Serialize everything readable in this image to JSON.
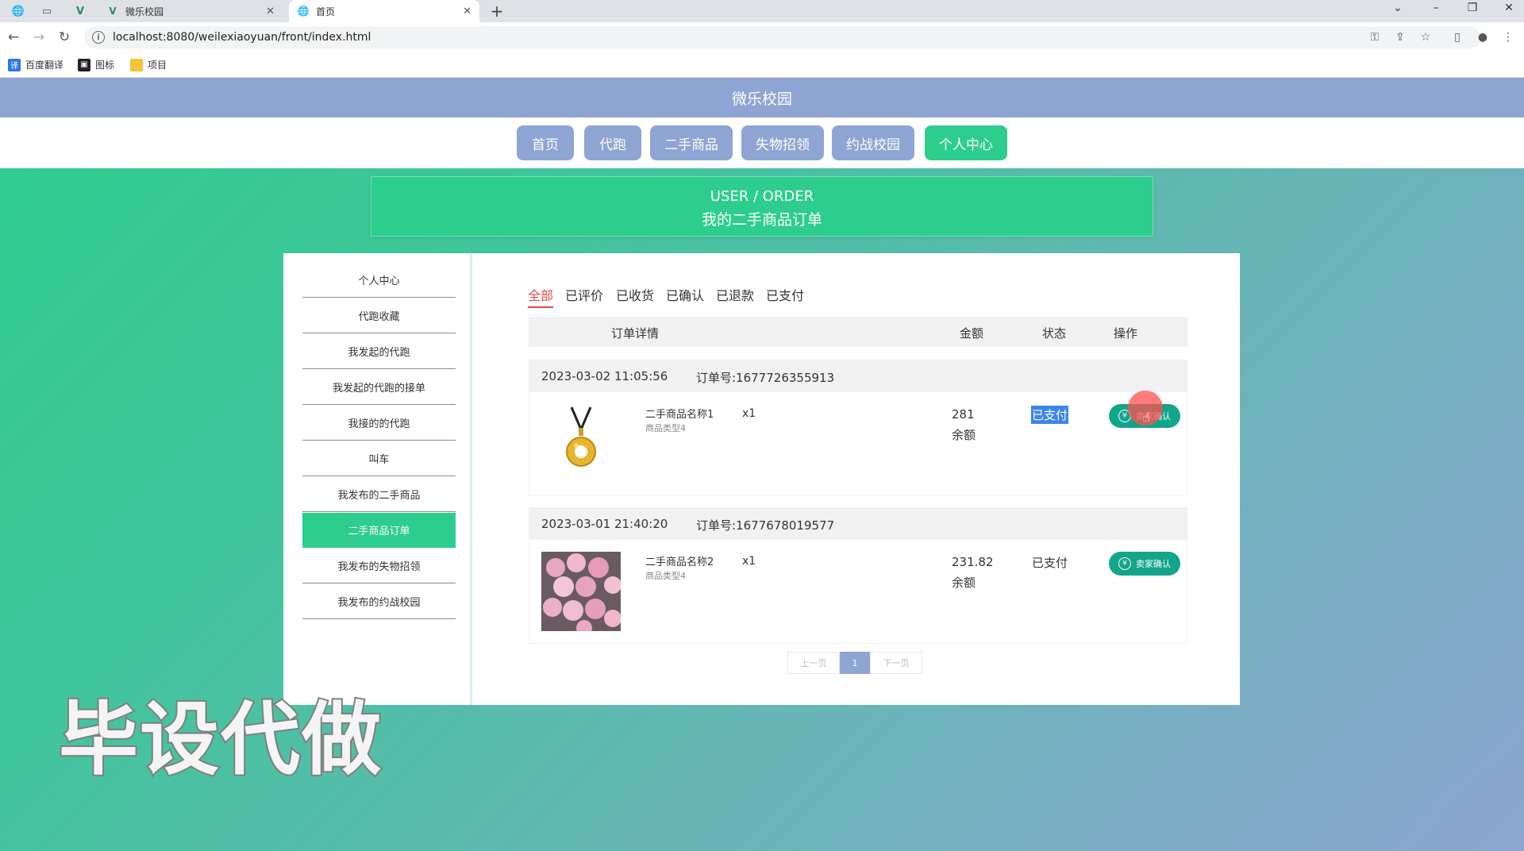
{
  "browser": {
    "tabs": [
      {
        "title": "微乐校园",
        "active": false
      },
      {
        "title": "首页",
        "active": true
      }
    ],
    "url": "localhost:8080/weilexiaoyuan/front/index.html",
    "bookmarks": [
      "百度翻译",
      "图标",
      "项目"
    ],
    "icons": {
      "back": "←",
      "forward": "→",
      "reload": "↻",
      "new_tab": "+",
      "close": "✕"
    }
  },
  "site": {
    "title": "微乐校园",
    "nav": [
      "首页",
      "代跑",
      "二手商品",
      "失物招领",
      "约战校园",
      "个人中心"
    ],
    "active_nav": "个人中心"
  },
  "banner": {
    "en": "USER / ORDER",
    "cn": "我的二手商品订单"
  },
  "sidebar": {
    "items": [
      "个人中心",
      "代跑收藏",
      "我发起的代跑",
      "我发起的代跑的接单",
      "我接的的代跑",
      "叫车",
      "我发布的二手商品",
      "二手商品订单",
      "我发布的失物招领",
      "我发布的约战校园"
    ],
    "active": "二手商品订单"
  },
  "filters": {
    "items": [
      "全部",
      "已评价",
      "已收货",
      "已确认",
      "已退款",
      "已支付"
    ],
    "active": "全部"
  },
  "table": {
    "headers": [
      "订单详情",
      "金额",
      "状态",
      "操作"
    ]
  },
  "orders": [
    {
      "time": "2023-03-02 11:05:56",
      "order_no": "订单号:1677726355913",
      "name": "二手商品名称1",
      "type": "商品类型4",
      "qty": "x1",
      "amount": "281",
      "pay_method": "余额",
      "status": "已支付",
      "action": "卖家确认"
    },
    {
      "time": "2023-03-01 21:40:20",
      "order_no": "订单号:1677678019577",
      "name": "二手商品名称2",
      "type": "商品类型4",
      "qty": "x1",
      "amount": "231.82",
      "pay_method": "余额",
      "status": "已支付",
      "action": "卖家确认"
    }
  ],
  "pager": {
    "prev": "上一页",
    "current": "1",
    "next": "下一页"
  },
  "watermark": "毕设代做",
  "colors": {
    "primary": "#2dcd8e",
    "secondary": "#8ea4d2",
    "action": "#13a58a",
    "filter_active": "#e24b4b"
  }
}
